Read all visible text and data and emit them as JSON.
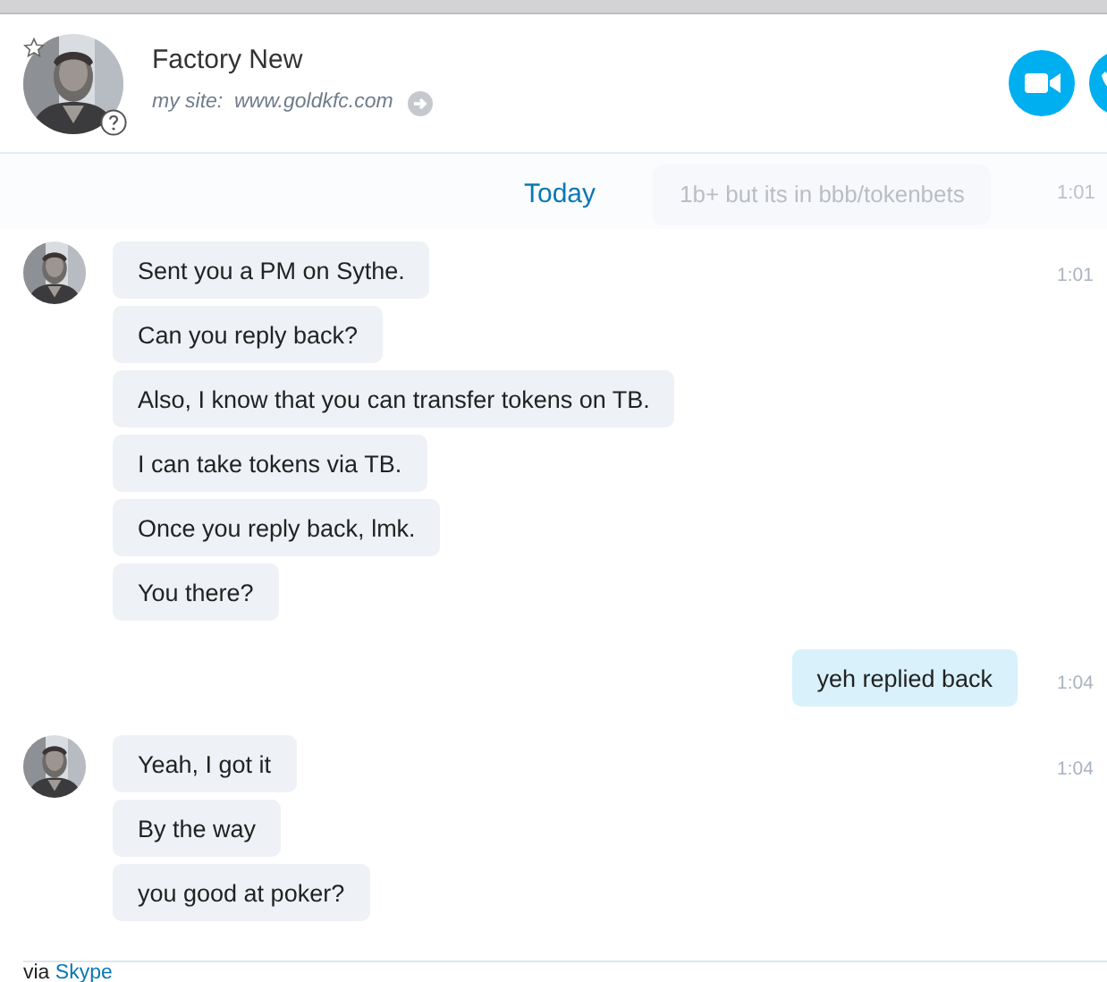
{
  "contact": {
    "name": "Factory New",
    "site_label": "my site:",
    "site_url": "www.goldkfc.com"
  },
  "date_bar": {
    "label": "Today",
    "faded_message": "1b+ but its in bbb/tokenbets",
    "faded_time": "1:01"
  },
  "groups": [
    {
      "kind": "in",
      "time": "1:01",
      "messages": [
        "Sent you a PM on Sythe.",
        "Can you reply back?",
        "Also, I know that you can transfer tokens on TB.",
        "I can take tokens via TB.",
        "Once you reply back, lmk.",
        "You there?"
      ]
    },
    {
      "kind": "out",
      "time": "1:04",
      "messages": [
        "yeh replied back"
      ]
    },
    {
      "kind": "in",
      "time": "1:04",
      "messages": [
        "Yeah, I got it",
        "By the way",
        "you good at poker?"
      ]
    }
  ],
  "footer": {
    "prefix": "via",
    "link": "Skype"
  }
}
